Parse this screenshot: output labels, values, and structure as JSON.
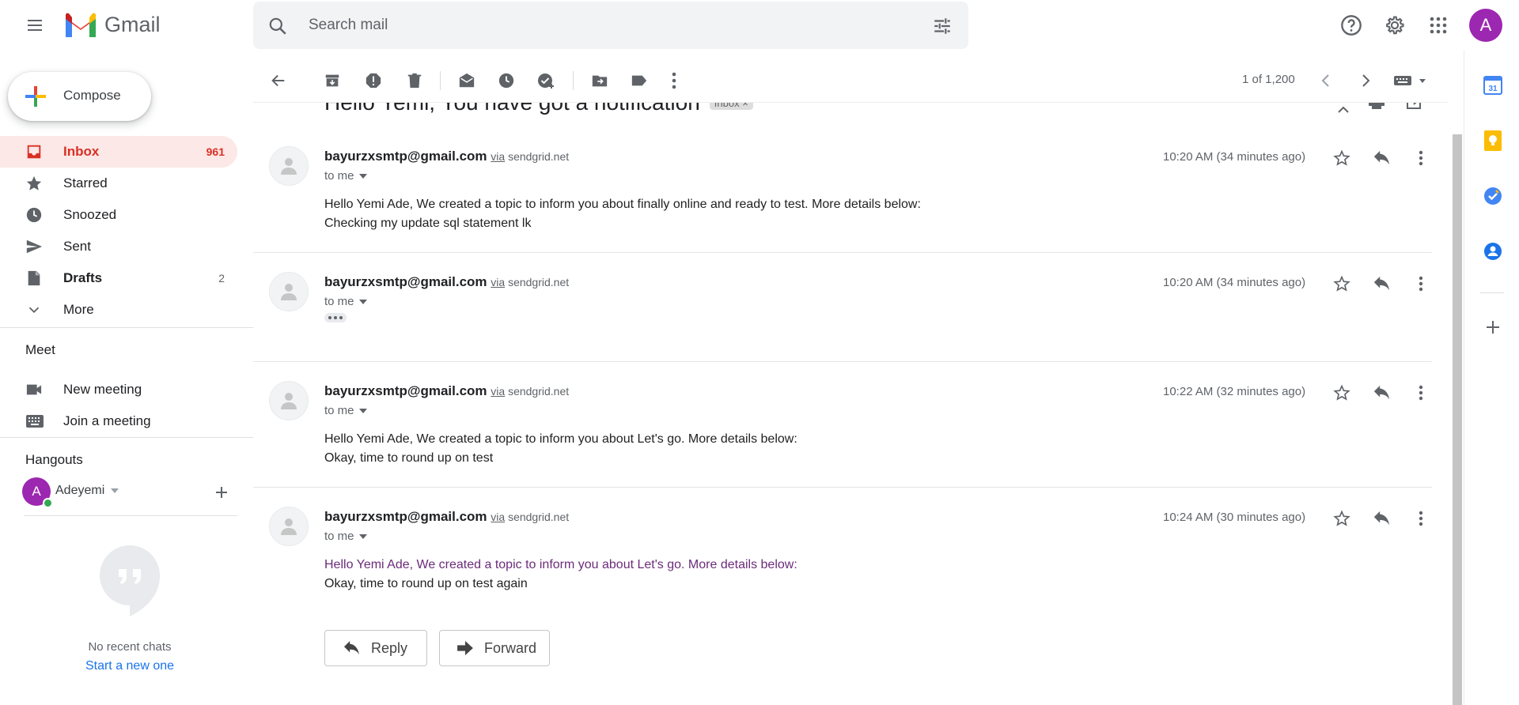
{
  "app": {
    "logo_text": "Gmail"
  },
  "search": {
    "placeholder": "Search mail"
  },
  "header": {
    "avatar_letter": "A"
  },
  "compose": {
    "label": "Compose"
  },
  "nav": [
    {
      "label": "Inbox",
      "count": "961",
      "icon": "inbox-icon"
    },
    {
      "label": "Starred",
      "count": "",
      "icon": "star-icon"
    },
    {
      "label": "Snoozed",
      "count": "",
      "icon": "clock-icon"
    },
    {
      "label": "Sent",
      "count": "",
      "icon": "send-icon"
    },
    {
      "label": "Drafts",
      "count": "2",
      "icon": "draft-icon"
    },
    {
      "label": "More",
      "count": "",
      "icon": "chevron-down-icon"
    }
  ],
  "meet": {
    "title": "Meet",
    "new_meeting": "New meeting",
    "join_meeting": "Join a meeting"
  },
  "hangouts": {
    "title": "Hangouts",
    "user": "Adeyemi",
    "user_initial": "A",
    "no_chats": "No recent chats",
    "start_new": "Start a new one"
  },
  "toolbar": {
    "pager": "1 of 1,200"
  },
  "thread": {
    "subject": "Hello Yemi, You have got a notification",
    "label_badge": "Inbox ×",
    "messages": [
      {
        "sender": "bayurzxsmtp@gmail.com",
        "via_label": "via",
        "via_domain": "sendgrid.net",
        "to": "to me",
        "time": "10:20 AM (34 minutes ago)",
        "line1": "Hello Yemi Ade, We created a topic to inform you about finally online and ready to test. More details below:",
        "line2": "Checking my update sql statement lk"
      },
      {
        "sender": "bayurzxsmtp@gmail.com",
        "via_label": "via",
        "via_domain": "sendgrid.net",
        "to": "to me",
        "time": "10:20 AM (34 minutes ago)",
        "line1": "",
        "line2": ""
      },
      {
        "sender": "bayurzxsmtp@gmail.com",
        "via_label": "via",
        "via_domain": "sendgrid.net",
        "to": "to me",
        "time": "10:22 AM (32 minutes ago)",
        "line1": "Hello Yemi Ade, We created a topic to inform you about Let's go. More details below:",
        "line2": "Okay, time to round up on test"
      },
      {
        "sender": "bayurzxsmtp@gmail.com",
        "via_label": "via",
        "via_domain": "sendgrid.net",
        "to": "to me",
        "time": "10:24 AM (30 minutes ago)",
        "line1": "Hello Yemi Ade, We created a topic to inform you about Let's go. More details below:",
        "line2": "Okay, time to round up on test again"
      }
    ],
    "reply_label": "Reply",
    "forward_label": "Forward"
  },
  "side_panel": {
    "calendar_day": "31"
  },
  "colors": {
    "inbox_active_bg": "#fce8e6",
    "inbox_active_text": "#d93025",
    "avatar": "#9c27b0",
    "online": "#34a853"
  }
}
